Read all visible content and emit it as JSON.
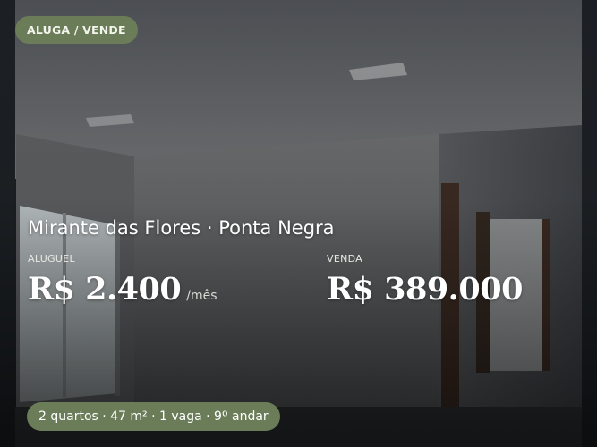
{
  "listing": {
    "tag": "ALUGA / VENDE",
    "title": "Mirante das Flores · Ponta Negra",
    "rent": {
      "label": "ALUGUEL",
      "value": "R$ 2.400",
      "unit": "/mês"
    },
    "sale": {
      "label": "VENDA",
      "value": "R$ 389.000"
    },
    "features": "2 quartos · 47 m² · 1 vaga · 9º andar"
  },
  "colors": {
    "badge_background": "#6b7c58",
    "text_primary": "#ffffff"
  }
}
